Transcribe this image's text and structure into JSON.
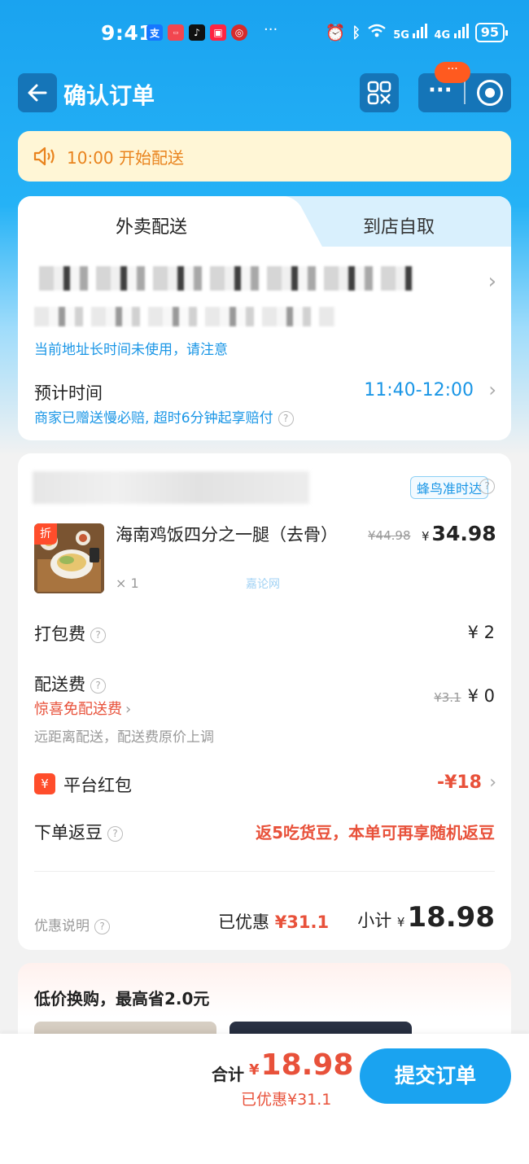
{
  "status_bar": {
    "time": "9:41",
    "more": "···",
    "network_5g": "5G",
    "network_4g": "4G",
    "battery": "95"
  },
  "nav": {
    "title": "确认订单",
    "capsule_badge": "···",
    "capsule_more": "···"
  },
  "notice": {
    "text": "10:00 开始配送"
  },
  "delivery": {
    "tabs": [
      {
        "label": "外卖配送",
        "active": true
      },
      {
        "label": "到店自取",
        "active": false
      }
    ],
    "address_note": "当前地址长时间未使用，请注意",
    "eta_label": "预计时间",
    "eta_value": "11:40-12:00",
    "eta_sub": "商家已赠送慢必赔, 超时6分钟起享赔付"
  },
  "order": {
    "delivery_tag": "蜂鸟准时达",
    "item": {
      "tag": "折",
      "name": "海南鸡饭四分之一腿（去骨）",
      "qty": "× 1",
      "old_price": "¥44.98",
      "yen": "¥",
      "price": "34.98"
    },
    "watermark": "嘉论网",
    "packing_label": "打包费",
    "packing_value": "¥ 2",
    "shipping_label": "配送费",
    "shipping_old": "¥3.1",
    "shipping_value": "¥ 0",
    "shipping_promo": "惊喜免配送费",
    "shipping_note": "远距离配送，配送费原价上调",
    "redpacket_icon": "¥",
    "redpacket_label": "平台红包",
    "redpacket_value": "-¥18",
    "bean_label": "下单返豆",
    "bean_value": "返5吃货豆，本单可再享随机返豆",
    "discount_label": "优惠说明",
    "saved_label": "已优惠",
    "saved_value": "¥31.1",
    "subtotal_label": "小计",
    "subtotal_yen": "¥",
    "subtotal_value": "18.98"
  },
  "upsell": {
    "title": "低价换购，最高省2.0元"
  },
  "footer": {
    "total_label": "合计",
    "total_yen": "¥",
    "total_value": "18.98",
    "saved": "已优惠¥31.1",
    "submit_label": "提交订单"
  },
  "colors": {
    "primary_blue": "#1aa3f0",
    "price_red": "#e8513a",
    "notice_orange": "#e9831d"
  },
  "icons": [
    "back-arrow-icon",
    "qr-scan-icon",
    "more-icon",
    "close-target-icon",
    "speaker-icon",
    "chevron-right-icon",
    "question-icon",
    "redpacket-icon"
  ]
}
